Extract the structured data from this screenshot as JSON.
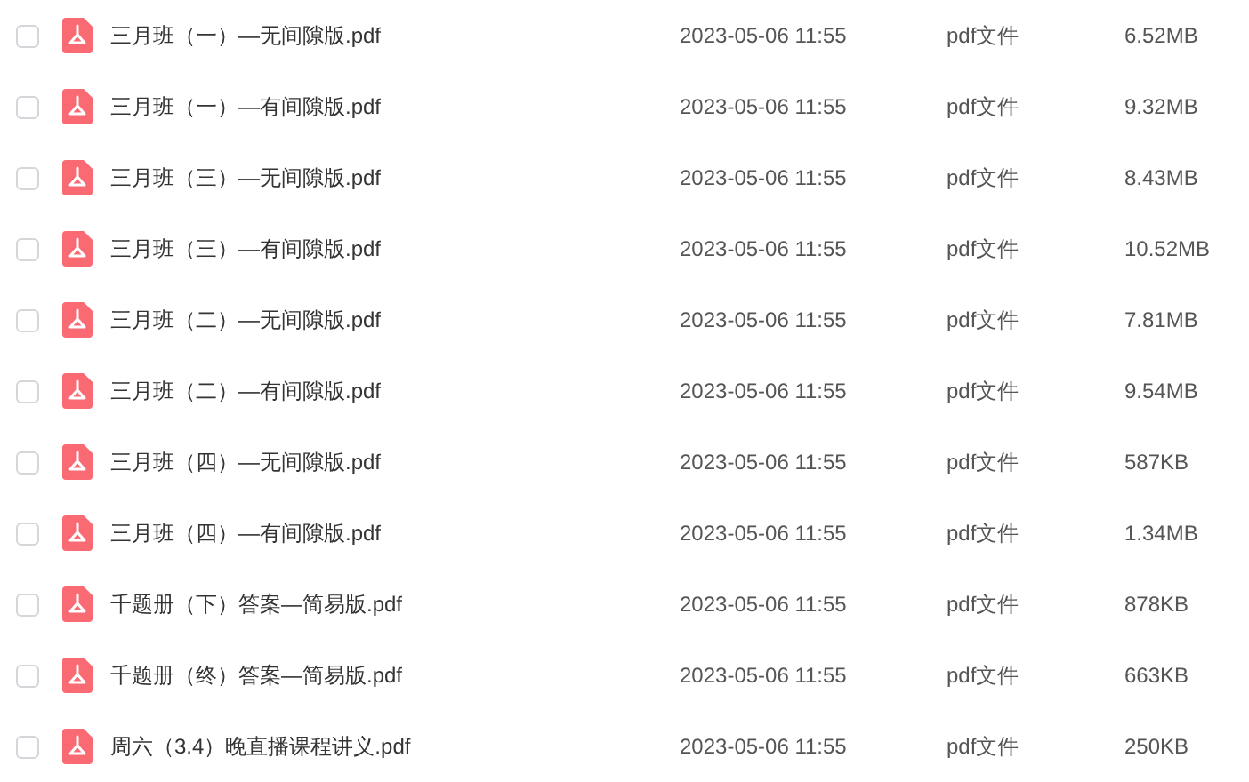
{
  "files": [
    {
      "name": "三月班（一）—无间隙版.pdf",
      "modified": "2023-05-06 11:55",
      "type": "pdf文件",
      "size": "6.52MB",
      "checked": false
    },
    {
      "name": "三月班（一）—有间隙版.pdf",
      "modified": "2023-05-06 11:55",
      "type": "pdf文件",
      "size": "9.32MB",
      "checked": false
    },
    {
      "name": "三月班（三）—无间隙版.pdf",
      "modified": "2023-05-06 11:55",
      "type": "pdf文件",
      "size": "8.43MB",
      "checked": false
    },
    {
      "name": "三月班（三）—有间隙版.pdf",
      "modified": "2023-05-06 11:55",
      "type": "pdf文件",
      "size": "10.52MB",
      "checked": false
    },
    {
      "name": "三月班（二）—无间隙版.pdf",
      "modified": "2023-05-06 11:55",
      "type": "pdf文件",
      "size": "7.81MB",
      "checked": false
    },
    {
      "name": "三月班（二）—有间隙版.pdf",
      "modified": "2023-05-06 11:55",
      "type": "pdf文件",
      "size": "9.54MB",
      "checked": false
    },
    {
      "name": "三月班（四）—无间隙版.pdf",
      "modified": "2023-05-06 11:55",
      "type": "pdf文件",
      "size": "587KB",
      "checked": false
    },
    {
      "name": "三月班（四）—有间隙版.pdf",
      "modified": "2023-05-06 11:55",
      "type": "pdf文件",
      "size": "1.34MB",
      "checked": false
    },
    {
      "name": "千题册（下）答案—简易版.pdf",
      "modified": "2023-05-06 11:55",
      "type": "pdf文件",
      "size": "878KB",
      "checked": false
    },
    {
      "name": "千题册（终）答案—简易版.pdf",
      "modified": "2023-05-06 11:55",
      "type": "pdf文件",
      "size": "663KB",
      "checked": false
    },
    {
      "name": "周六（3.4）晚直播课程讲义.pdf",
      "modified": "2023-05-06 11:55",
      "type": "pdf文件",
      "size": "250KB",
      "checked": false
    }
  ]
}
